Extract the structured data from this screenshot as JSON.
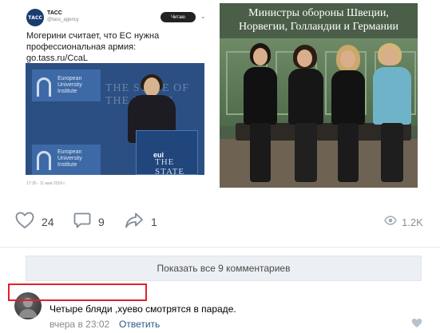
{
  "post": {
    "tweet": {
      "account_logo": "ТАСС",
      "account_name": "ТАСС",
      "account_handle": "@tass_agency",
      "follow_label": "Читаю",
      "text_lines": [
        "Могерини считает, что ЕС нужна",
        "профессиональная армия:",
        "go.tass.ru/CcaL"
      ],
      "photo": {
        "banner_text_1": "European University Institute",
        "banner_text_2": "European University Institute",
        "bg_text": "THE STATE OF THE UNION",
        "podium_text": "THE STATE",
        "podium_logo": "eui"
      },
      "timestamp": "17:35 - 11 мая 2018 г."
    },
    "photo2": {
      "caption_lines": [
        "Министры обороны Швеции,",
        "Норвегии, Голландии и Германии"
      ]
    }
  },
  "actions": {
    "likes_count": "24",
    "comments_count": "9",
    "shares_count": "1",
    "views_count": "1.2K",
    "like_icon": "heart-icon",
    "comment_icon": "comment-bubble-icon",
    "share_icon": "share-arrow-icon",
    "views_icon": "eye-icon"
  },
  "comments": {
    "show_all_label": "Показать все 9 комментариев",
    "items": [
      {
        "text": "Четыре бляди ,хуево смотрятся в параде.",
        "time": "вчера в 23:02",
        "reply_label": "Ответить"
      }
    ]
  },
  "colors": {
    "accent_link": "#2a5885",
    "annotation_red": "#e0202c",
    "button_bg": "#eceff3"
  }
}
